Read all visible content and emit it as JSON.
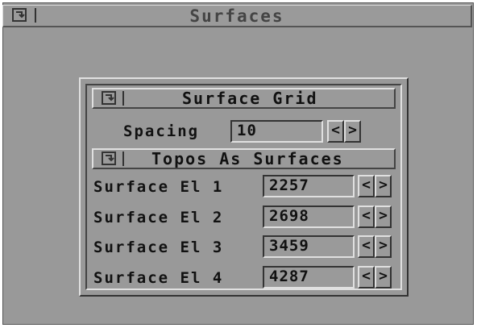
{
  "window": {
    "title": "Surfaces",
    "menu_icon": "window-menu-icon"
  },
  "surface_grid": {
    "title": "Surface Grid",
    "menu_icon": "window-menu-icon",
    "spacing_label": "Spacing",
    "spacing_value": "10"
  },
  "topos": {
    "title": "Topos As Surfaces",
    "menu_icon": "window-menu-icon",
    "rows": [
      {
        "label": "Surface El 1",
        "value": "2257"
      },
      {
        "label": "Surface El 2",
        "value": "2698"
      },
      {
        "label": "Surface El 3",
        "value": "3459"
      },
      {
        "label": "Surface El 4",
        "value": "4287"
      }
    ]
  },
  "arrows": {
    "left": "<",
    "right": ">"
  }
}
